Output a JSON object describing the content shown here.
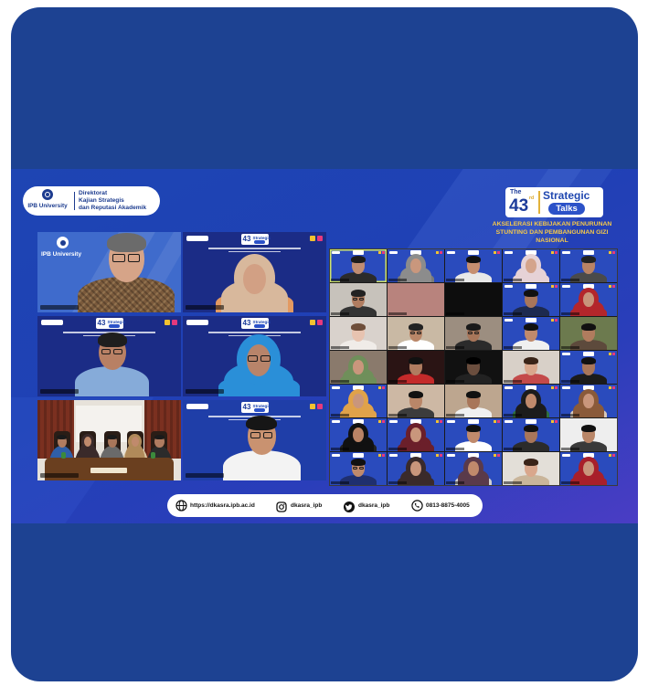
{
  "colors": {
    "card": "#1d4292",
    "banner_start": "#1e45b3",
    "banner_end": "#4a3dc4",
    "theme_text": "#f7c948",
    "logo_blue": "#1d3c9a"
  },
  "header": {
    "university": "IPB University",
    "directorate": [
      "Direktorat",
      "Kajian Strategis",
      "dan Reputasi Akademik"
    ]
  },
  "event": {
    "prefix": "The",
    "number": "43",
    "suffix": "rd",
    "title_top": "Strategic",
    "title_bottom": "Talks",
    "theme": [
      "AKSELERASI KEBIJAKAN PENURUNAN",
      "STUNTING DAN PEMBANGUNAN GIZI",
      "NASIONAL"
    ]
  },
  "speakers": [
    {
      "bg": "#3f6bcc",
      "university_backdrop": true,
      "person": {
        "skin": "#d6a488",
        "hair": "#6b6b6b",
        "shirt": "#7a5a3c",
        "glasses": true,
        "patterned_shirt": true
      }
    },
    {
      "bg": "#1b2c86",
      "header": true,
      "person": {
        "skin": "#d2a084",
        "hijab": "#d8b89c",
        "shirt": "#e39a62"
      }
    },
    {
      "bg": "#1b2c86",
      "header": true,
      "person": {
        "skin": "#b88064",
        "hair": "#1e1e1e",
        "shirt": "#86abd9",
        "glasses": true
      }
    },
    {
      "bg": "#1b2c86",
      "header": true,
      "person": {
        "skin": "#b8846a",
        "hijab": "#2a8fd8",
        "shirt": "#2a8fd8",
        "glasses": true
      }
    },
    {
      "bg": "#e7e2da",
      "meeting_room": {
        "curtain": "#7b3020",
        "table": "#6a3f1f",
        "chair": "#2a1d16",
        "people": [
          {
            "skin": "#b07c60",
            "hair": "#1a1a1a",
            "shirt": "#2f5fa8"
          },
          {
            "skin": "#c08a6c",
            "hijab": "#3a2a2a",
            "shirt": "#3a2a2a"
          },
          {
            "skin": "#a8765a",
            "hair": "#1a1a1a",
            "shirt": "#6a6a6a"
          },
          {
            "skin": "#c08a6c",
            "hijab": "#b08a5a",
            "shirt": "#d9c5a0"
          },
          {
            "skin": "#b07c60",
            "hair": "#1a1a1a",
            "shirt": "#2b2b2b"
          }
        ]
      }
    },
    {
      "bg": "#1f3ea8",
      "header": true,
      "person": {
        "skin": "#c99270",
        "hair": "#161616",
        "shirt": "#f3f3f3",
        "glasses": true
      }
    }
  ],
  "participants": [
    {
      "bg": "#2a4bbd",
      "header": true,
      "active": true,
      "person": {
        "skin": "#c08d72",
        "hair": "#1c1c1c",
        "shirt": "#2b2b2b"
      }
    },
    {
      "bg": "#2a4bbd",
      "header": true,
      "person": {
        "skin": "#c9977d",
        "hijab": "#8c8c8c",
        "shirt": "#7a7a7a"
      }
    },
    {
      "bg": "#2a4bbd",
      "header": true,
      "person": {
        "skin": "#c68f70",
        "hair": "#111111",
        "shirt": "#e8e8e8"
      }
    },
    {
      "bg": "#2a4bbd",
      "header": true,
      "person": {
        "skin": "#d4a48c",
        "hijab": "#e6d2d6",
        "shirt": "#e6d2d6"
      }
    },
    {
      "bg": "#2a4bbd",
      "header": true,
      "person": {
        "skin": "#b98365",
        "hair": "#222222",
        "shirt": "#4a4a4a"
      }
    },
    {
      "bg": "#c7c2bb",
      "person": {
        "skin": "#b07c60",
        "hair": "#222222",
        "shirt": "#333333",
        "glasses": true
      }
    },
    {
      "bg": "#b8837d"
    },
    {
      "bg": "#0d0d0d"
    },
    {
      "bg": "#2a4bbd",
      "header": true,
      "person": {
        "skin": "#a8765a",
        "hair": "#111111",
        "shirt": "#1d2a50"
      }
    },
    {
      "bg": "#2a4bbd",
      "header": true,
      "person": {
        "skin": "#c8957a",
        "hijab": "#b3262b",
        "shirt": "#b3262b"
      }
    },
    {
      "bg": "#d9d2cc",
      "person": {
        "skin": "#e7c3b0",
        "hair": "#6e4e3a",
        "shirt": "#f0ece8"
      }
    },
    {
      "bg": "#c9b9a4",
      "person": {
        "skin": "#b98668",
        "hair": "#222222",
        "shirt": "#ffffff",
        "glasses": true
      }
    },
    {
      "bg": "#9c8e80",
      "person": {
        "skin": "#a8765a",
        "hair": "#1a1a1a",
        "shirt": "#2b2b2b",
        "glasses": true
      }
    },
    {
      "bg": "#2a4bbd",
      "header": true,
      "person": {
        "skin": "#c08a6c",
        "hair": "#111111",
        "shirt": "#f0f0f0"
      }
    },
    {
      "bg": "#6c7a4e",
      "person": {
        "skin": "#b07c5e",
        "hair": "#111111",
        "shirt": "#5d4a3c"
      }
    },
    {
      "bg": "#8a7a6c",
      "person": {
        "skin": "#c9967c",
        "hijab": "#6f8f5a",
        "shirt": "#6f8f5a"
      }
    },
    {
      "bg": "#2a1414",
      "person": {
        "skin": "#b07c60",
        "hair": "#111111",
        "shirt": "#c42a2a"
      }
    },
    {
      "bg": "#111111",
      "person": {
        "skin": "#6b4e3e",
        "hair": "#000000",
        "shirt": "#222222"
      }
    },
    {
      "bg": "#d8d0c8",
      "person": {
        "skin": "#d9a78c",
        "hair": "#3a2418",
        "shirt": "#c44a4a"
      }
    },
    {
      "bg": "#2a4bbd",
      "header": true,
      "person": {
        "skin": "#a8765a",
        "hair": "#111111",
        "shirt": "#1b1b1b"
      }
    },
    {
      "bg": "#2a4bbd",
      "header": true,
      "person": {
        "skin": "#c9967c",
        "hijab": "#e0a24a",
        "shirt": "#e0a24a"
      }
    },
    {
      "bg": "#cdb8a4",
      "person": {
        "skin": "#b98668",
        "hair": "#111111",
        "shirt": "#3c3c3c"
      }
    },
    {
      "bg": "#bda68f",
      "person": {
        "skin": "#a8765a",
        "hair": "#111111",
        "shirt": "#f0f0f0"
      }
    },
    {
      "bg": "#2a4bbd",
      "header": true,
      "person": {
        "skin": "#c08a6c",
        "hijab": "#1c1c1c",
        "shirt": "#2f6f3f"
      }
    },
    {
      "bg": "#2a4bbd",
      "header": true,
      "person": {
        "skin": "#c9967c",
        "hijab": "#8a5a3a",
        "shirt": "#d9c9b9"
      }
    },
    {
      "bg": "#2a4bbd",
      "header": true,
      "person": {
        "skin": "#b98365",
        "hijab": "#111111",
        "shirt": "#222222"
      }
    },
    {
      "bg": "#2a4bbd",
      "header": true,
      "person": {
        "skin": "#c9967c",
        "hijab": "#6b1f2a",
        "shirt": "#6b1f2a"
      }
    },
    {
      "bg": "#2a4bbd",
      "header": true,
      "person": {
        "skin": "#c08a6c",
        "hair": "#111111",
        "shirt": "#ffffff"
      }
    },
    {
      "bg": "#2a4bbd",
      "header": true,
      "person": {
        "skin": "#a8765a",
        "hair": "#111111",
        "shirt": "#2b2b2b"
      }
    },
    {
      "bg": "#eeeeee",
      "person": {
        "skin": "#b98668",
        "hair": "#111111",
        "shirt": "#3a3a3a"
      }
    },
    {
      "bg": "#2a4bbd",
      "header": true,
      "person": {
        "skin": "#c08a6c",
        "hair": "#111111",
        "shirt": "#1f2f6f",
        "glasses": true
      }
    },
    {
      "bg": "#2a4bbd",
      "header": true,
      "person": {
        "skin": "#c9967c",
        "hijab": "#3a2a2a",
        "shirt": "#3a2a2a"
      }
    },
    {
      "bg": "#2a4bbd",
      "header": true,
      "person": {
        "skin": "#c08a6c",
        "hijab": "#5a3a4a",
        "shirt": "#d0d0d0"
      }
    },
    {
      "bg": "#e3dfd8",
      "person": {
        "skin": "#d9a78c",
        "hair": "#3a2418",
        "shirt": "#c9b59a"
      }
    },
    {
      "bg": "#2a4bbd",
      "header": true,
      "person": {
        "skin": "#c9967c",
        "hijab": "#a81f2a",
        "shirt": "#a81f2a"
      }
    }
  ],
  "footer": {
    "website": "https://dkasra.ipb.ac.id",
    "instagram": "dkasra_ipb",
    "twitter": "dkasra_ipb",
    "phone": "0813-8875-4005",
    "icons": [
      "globe-icon",
      "instagram-icon",
      "twitter-icon",
      "phone-icon"
    ]
  }
}
